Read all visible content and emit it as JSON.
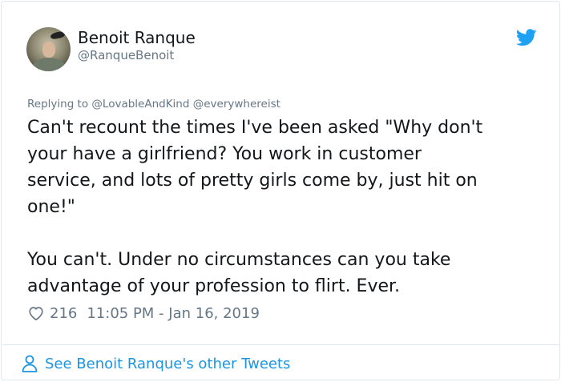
{
  "author": {
    "name": "Benoit Ranque",
    "handle": "@RanqueBenoit"
  },
  "replying": {
    "prefix": "Replying to",
    "mentions": [
      "@LovableAndKind",
      "@everywhereist"
    ]
  },
  "tweet": {
    "paragraphs": [
      "Can't recount the times I've been asked \"Why don't\nyour have a girlfriend? You work in customer\nservice, and lots of pretty girls come by, just hit on\none!\"",
      "You can't. Under no circumstances can you take\nadvantage of your profession to flirt. Ever."
    ],
    "like_count": "216",
    "timestamp": "11:05 PM - Jan 16, 2019"
  },
  "footer": {
    "see_more_label": "See Benoit Ranque's other Tweets"
  },
  "colors": {
    "brand_blue": "#1da1f2",
    "link_blue": "#1b95e0",
    "secondary_text": "#657786",
    "primary_text": "#14171a",
    "border": "#e1e8ed"
  },
  "icons": {
    "brand": "twitter-bird-icon",
    "like": "heart-icon",
    "profile": "person-icon"
  }
}
